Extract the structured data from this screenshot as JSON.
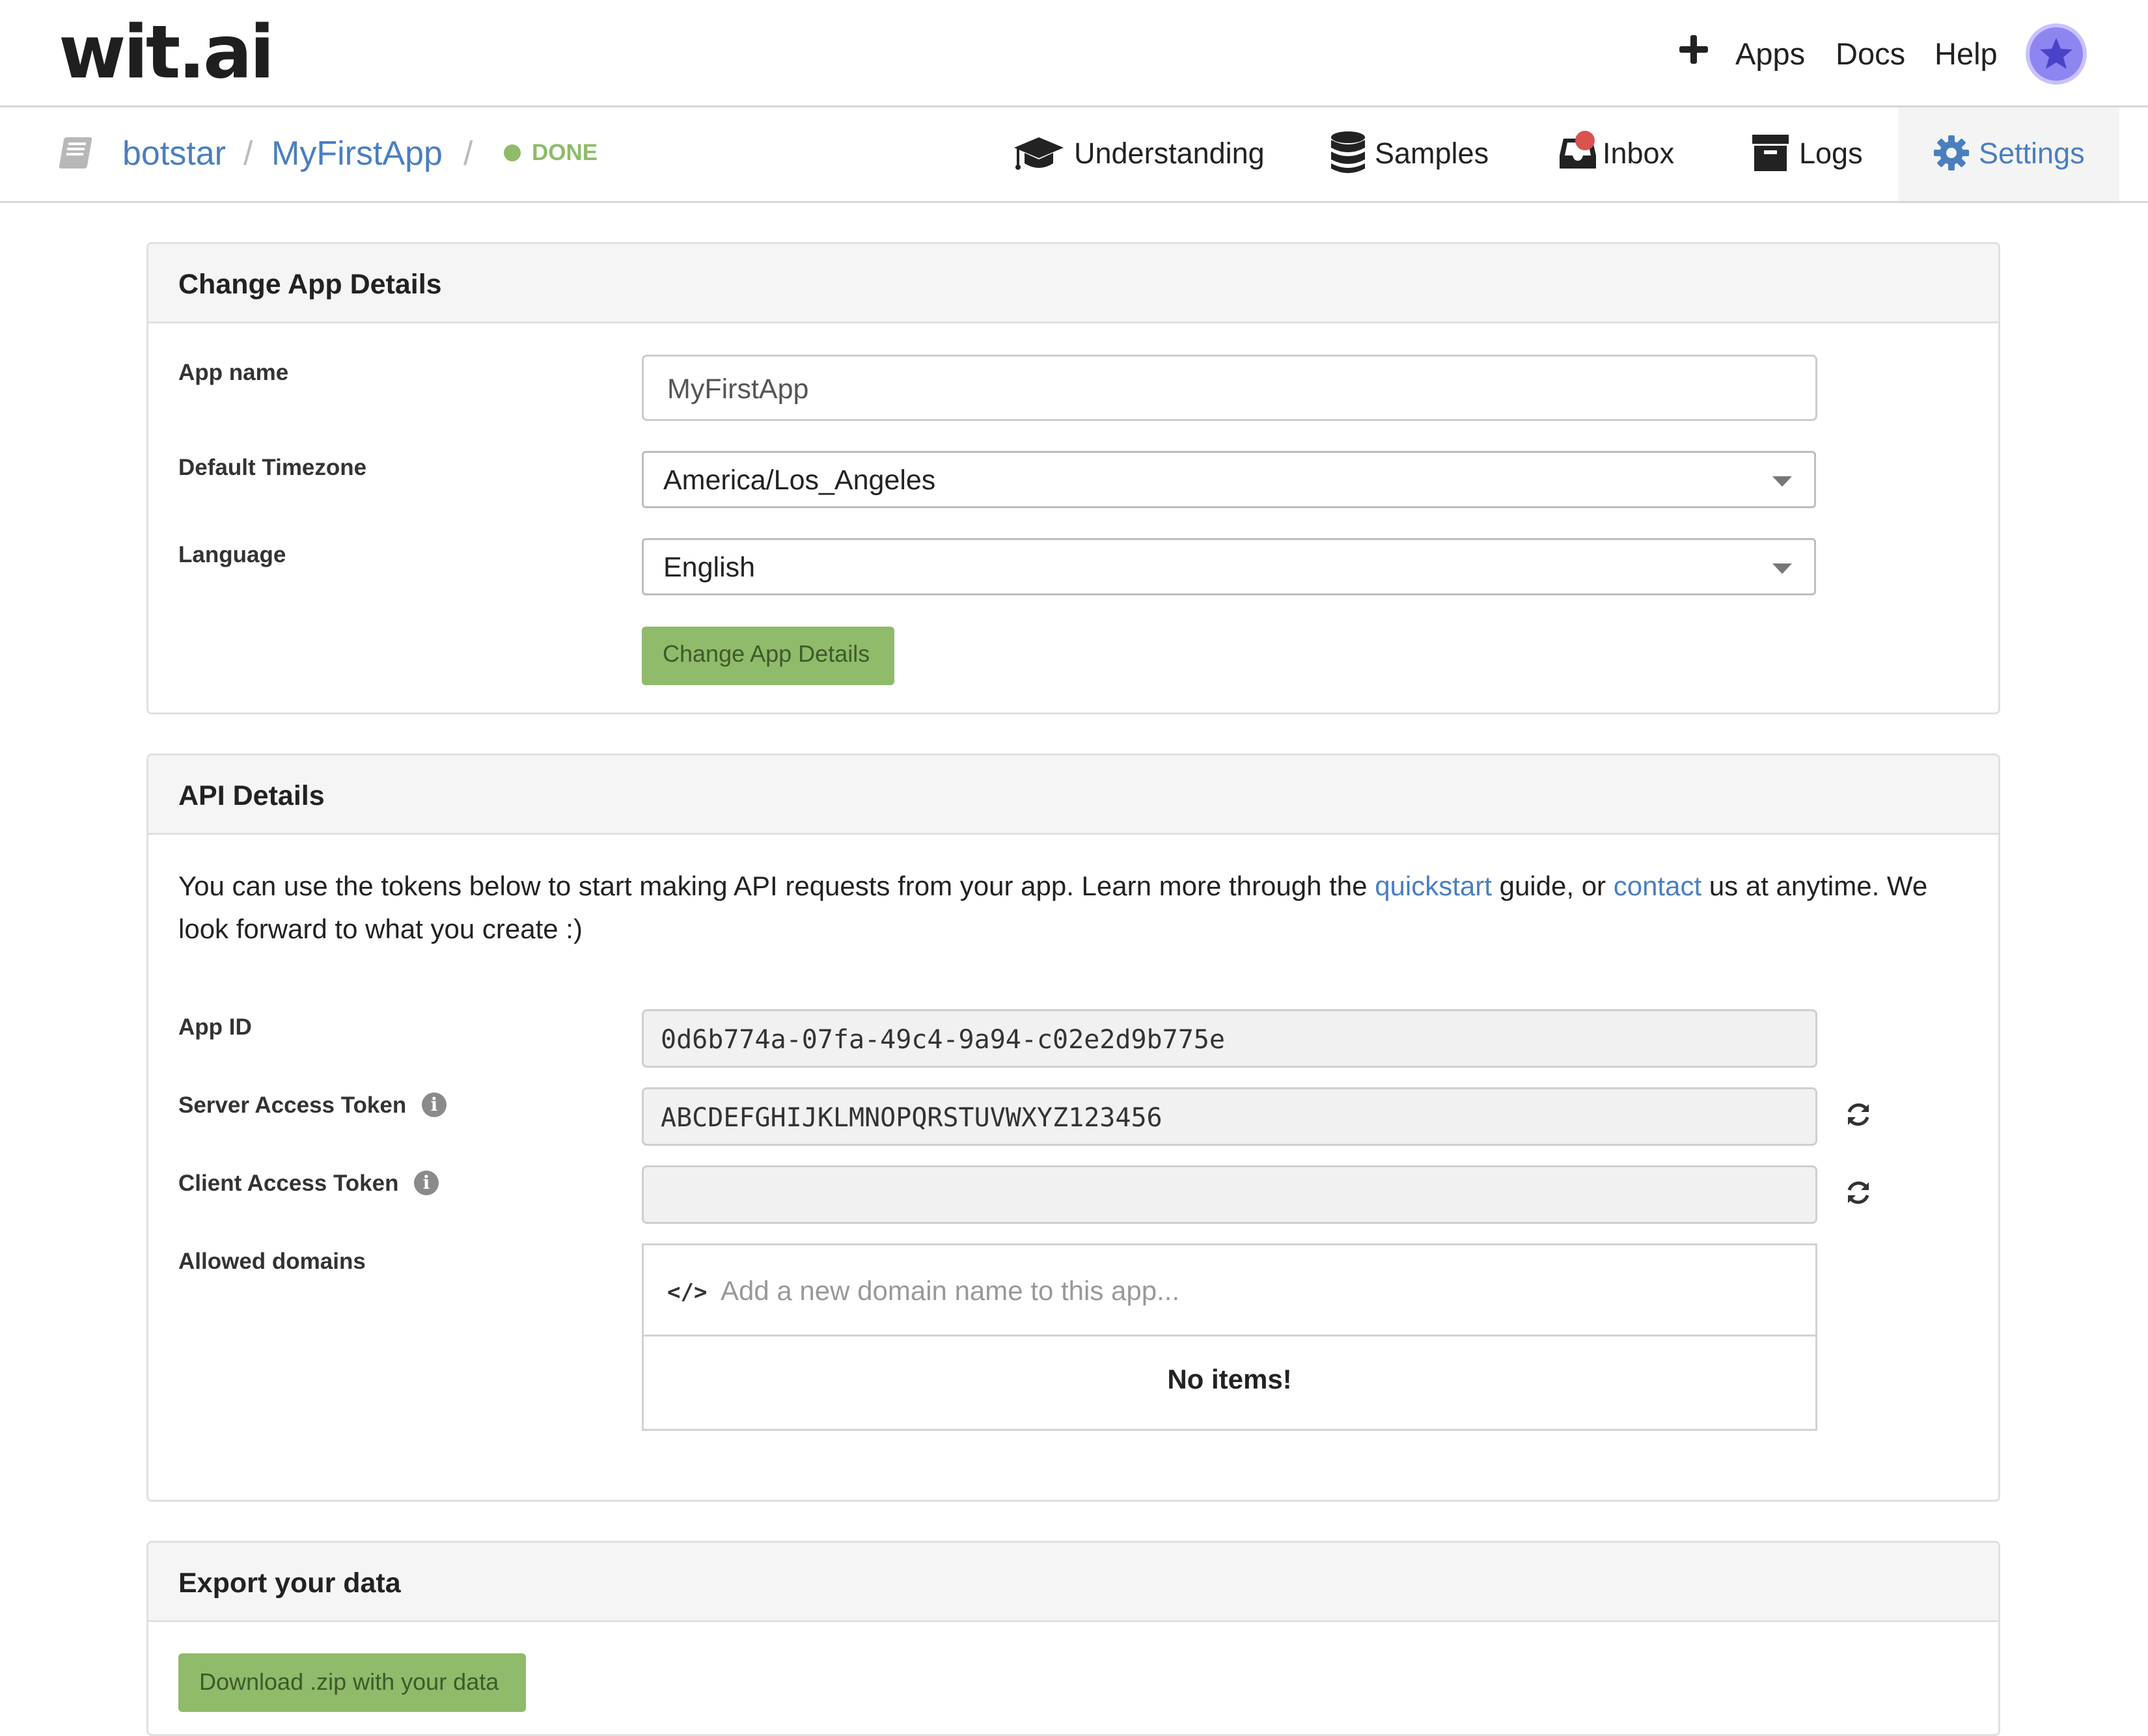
{
  "header": {
    "logo": "wit.ai",
    "nav": {
      "apps": "Apps",
      "docs": "Docs",
      "help": "Help"
    }
  },
  "breadcrumb": {
    "owner": "botstar",
    "separator": "/",
    "app": "MyFirstApp",
    "status": "DONE"
  },
  "tabs": {
    "understanding": "Understanding",
    "samples": "Samples",
    "inbox": "Inbox",
    "logs": "Logs",
    "settings": "Settings",
    "active": "Settings"
  },
  "app_details": {
    "title": "Change App Details",
    "app_name_label": "App name",
    "app_name_value": "MyFirstApp",
    "timezone_label": "Default Timezone",
    "timezone_value": "America/Los_Angeles",
    "language_label": "Language",
    "language_value": "English",
    "submit_label": "Change App Details"
  },
  "api_details": {
    "title": "API Details",
    "intro_1": "You can use the tokens below to start making API requests from your app. Learn more through the ",
    "quickstart_link": "quickstart",
    "intro_2": " guide, or ",
    "contact_link": "contact",
    "intro_3": " us at anytime. We look forward to what you create :)",
    "app_id_label": "App ID",
    "app_id_value": "0d6b774a-07fa-49c4-9a94-c02e2d9b775e",
    "server_token_label": "Server Access Token",
    "server_token_value": "ABCDEFGHIJKLMNOPQRSTUVWXYZ123456",
    "client_token_label": "Client Access Token",
    "client_token_value": "",
    "domains_label": "Allowed domains",
    "domains_placeholder": "Add a new domain name to this app...",
    "domains_empty": "No items!"
  },
  "export": {
    "title": "Export your data",
    "download_label": "Download .zip with your data"
  },
  "colors": {
    "link": "#4a7fbf",
    "success": "#8fbb6a",
    "notification": "#d9534f",
    "avatar": "#8e86f0"
  }
}
